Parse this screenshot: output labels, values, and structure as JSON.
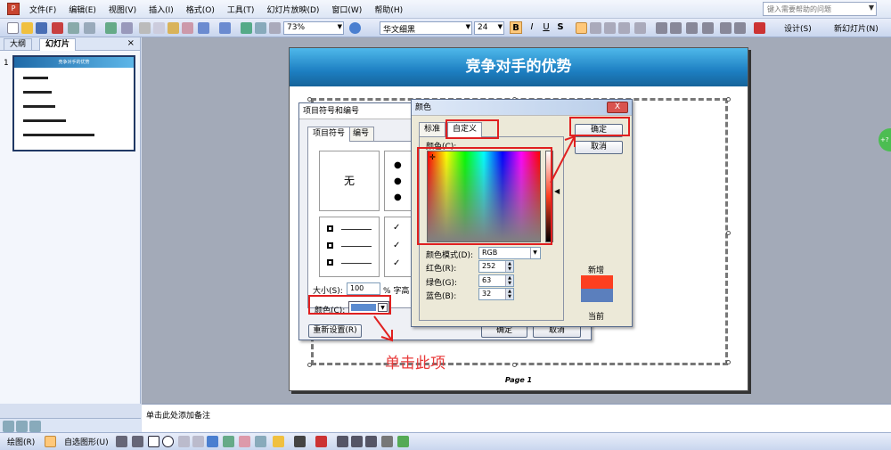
{
  "menubar": {
    "items": [
      "文件(F)",
      "编辑(E)",
      "视图(V)",
      "插入(I)",
      "格式(O)",
      "工具(T)",
      "幻灯片放映(D)",
      "窗口(W)",
      "帮助(H)"
    ],
    "help_placeholder": "键入需要帮助的问题"
  },
  "toolbar": {
    "zoom": "73%",
    "font": "华文细黑",
    "size": "24",
    "bold": "B",
    "italic": "I",
    "underline": "U",
    "shadow": "S",
    "design": "设计(S)",
    "new_slide": "新幻灯片(N)"
  },
  "left_panel": {
    "tabs": [
      "大纲",
      "幻灯片"
    ],
    "close": "×",
    "slide_number": "1",
    "thumb_title": "竞争对手的优势"
  },
  "slide": {
    "title": "竞争对手的优势",
    "footer": "Page   1"
  },
  "bullet_dialog": {
    "title": "项目符号和编号",
    "tabs": [
      "项目符号",
      "编号"
    ],
    "none_label": "无",
    "size_label": "大小(S):",
    "size_value": "100",
    "size_unit": "% 字高",
    "color_label": "颜色(C):",
    "reset": "重新设置(R)",
    "ok": "确定",
    "cancel": "取消"
  },
  "color_dialog": {
    "title": "颜色",
    "close": "X",
    "tabs": [
      "标准",
      "自定义"
    ],
    "colors_label": "颜色(C):",
    "model_label": "颜色模式(D):",
    "model_value": "RGB",
    "red_label": "红色(R):",
    "green_label": "绿色(G):",
    "blue_label": "蓝色(B):",
    "red": "252",
    "green": "63",
    "blue": "32",
    "ok": "确定",
    "cancel": "取消",
    "new_label": "新增",
    "current_label": "当前",
    "new_color": "#fc3f20",
    "current_color": "#5b7fbd"
  },
  "annotation": "单击此项",
  "notes": "单击此处添加备注",
  "drawbar": {
    "draw": "绘图(R)",
    "autoshapes": "自选图形(U)"
  },
  "colors": {
    "accent_red": "#e02020"
  }
}
